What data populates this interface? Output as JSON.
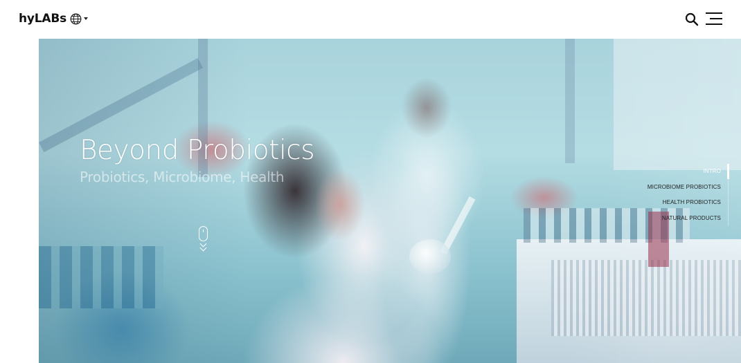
{
  "header": {
    "logo": "hyLABs",
    "language_icon": "globe-icon",
    "search_icon": "search-icon",
    "menu_icon": "hamburger-menu-icon"
  },
  "hero": {
    "title": "Beyond Probiotics",
    "subtitle": "Probiotics, Microbiome, Health",
    "scroll_icon": "mouse-scroll-icon"
  },
  "side_nav": {
    "items": [
      {
        "label": "INTRO",
        "active": true
      },
      {
        "label": "MICROBIOME PROBIOTICS",
        "active": false
      },
      {
        "label": "HEALTH PROBIOTICS",
        "active": false
      },
      {
        "label": "NATURAL PRODUCTS",
        "active": false
      }
    ]
  },
  "colors": {
    "header_bg": "#ffffff",
    "logo_text": "#111111",
    "hero_text": "#ffffff",
    "nav_text": "#222222"
  }
}
